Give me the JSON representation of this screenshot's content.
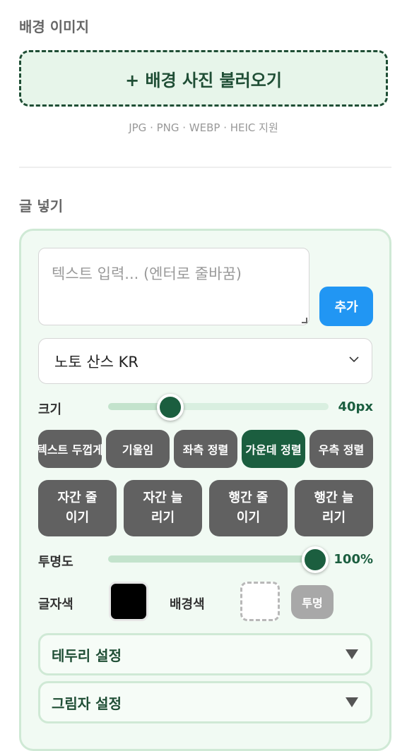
{
  "background_section": {
    "title": "배경 이미지",
    "upload_label": "+ 배경 사진 불러오기",
    "formats_note": "JPG · PNG · WEBP · HEIC 지원"
  },
  "text_section": {
    "title": "글 넣기",
    "text_input_placeholder": "텍스트 입력... (엔터로 줄바꿈)",
    "add_button": "추가",
    "font_select": {
      "selected": "노토 산스 KR"
    },
    "size": {
      "label": "크기",
      "value_text": "40px",
      "fraction": 0.25
    },
    "style_buttons": [
      {
        "label": "텍스트 두껍게",
        "active": false
      },
      {
        "label": "기울임",
        "active": false
      },
      {
        "label": "좌측 정렬",
        "active": false
      },
      {
        "label": "가운데 정렬",
        "active": true
      },
      {
        "label": "우측 정렬",
        "active": false
      }
    ],
    "spacing_buttons": [
      {
        "label": "자간 줄\n이기"
      },
      {
        "label": "자간 늘\n리기"
      },
      {
        "label": "행간 줄\n이기"
      },
      {
        "label": "행간 늘\n리기"
      }
    ],
    "opacity": {
      "label": "투명도",
      "value_text": "100%",
      "fraction": 1.0
    },
    "text_color": {
      "label": "글자색",
      "color": "#000000"
    },
    "bg_color": {
      "label": "배경색",
      "transparent_button": "투명"
    },
    "border_settings": {
      "label": "테두리 설정"
    },
    "shadow_settings": {
      "label": "그림자 설정"
    }
  },
  "colors": {
    "primary_dark_green": "#1b5e3f",
    "light_green": "#e7f5ea",
    "blue": "#2196f3",
    "gray_button": "#616161"
  }
}
